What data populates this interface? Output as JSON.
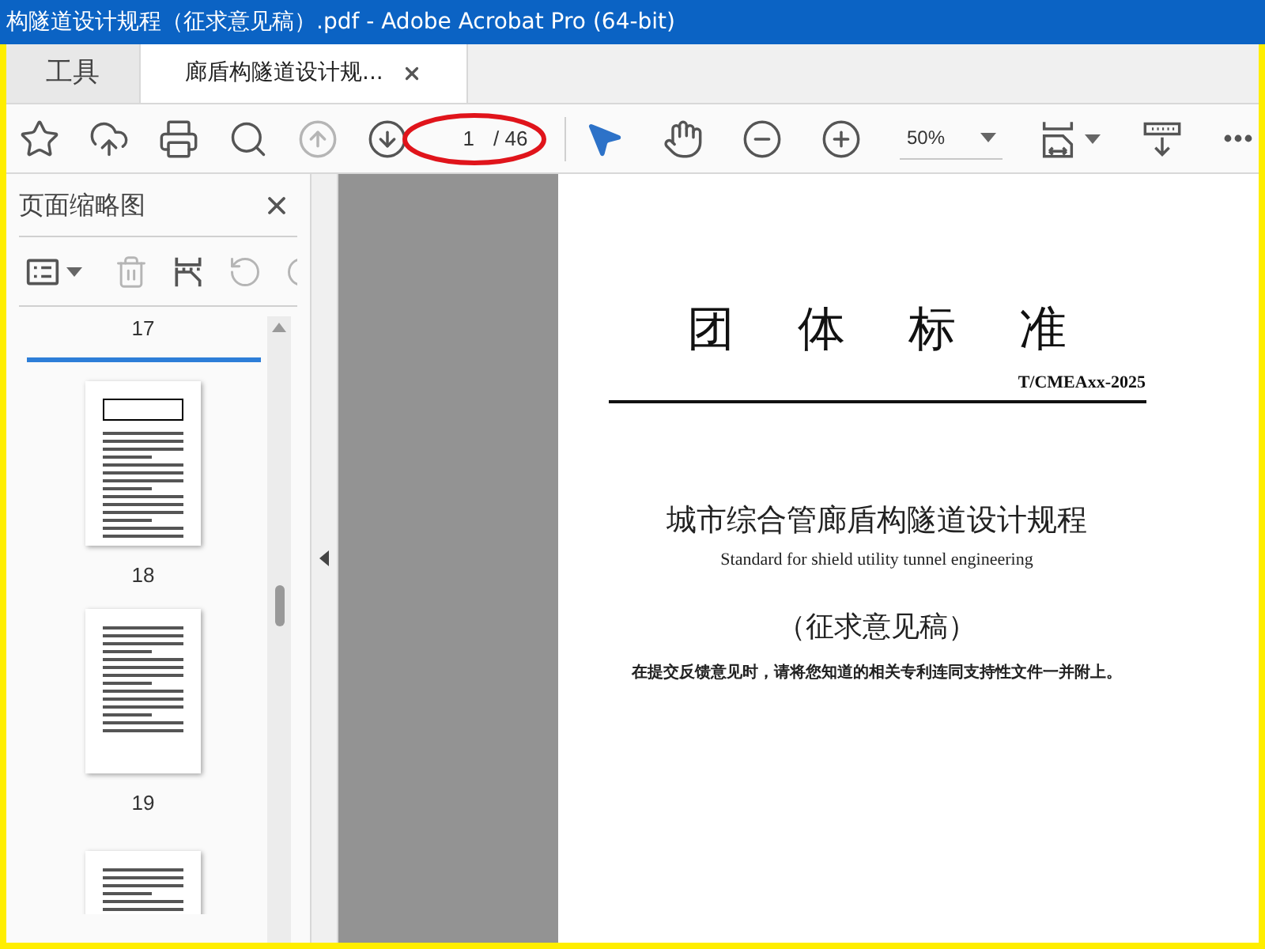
{
  "window": {
    "title": "构隧道设计规程（征求意见稿）.pdf - Adobe Acrobat Pro (64-bit)"
  },
  "tabs": [
    {
      "label": "工具",
      "selected": false,
      "closable": false
    },
    {
      "label": "廊盾构隧道设计规...",
      "selected": true,
      "closable": true
    }
  ],
  "toolbar": {
    "left": [
      {
        "kind": "star",
        "disabled": false
      },
      {
        "kind": "upload",
        "disabled": false
      },
      {
        "kind": "print",
        "disabled": false
      },
      {
        "kind": "search",
        "disabled": false
      },
      {
        "kind": "prev-page",
        "disabled": true
      },
      {
        "kind": "next-page",
        "disabled": false
      }
    ],
    "page": {
      "current": "1",
      "total": "/ 46"
    },
    "tools": [
      {
        "kind": "select",
        "selected": true
      },
      {
        "kind": "hand",
        "selected": false
      }
    ],
    "zoom": [
      {
        "kind": "zoom-out",
        "disabled": false
      },
      {
        "kind": "zoom-in",
        "disabled": false
      }
    ],
    "zoom_value": "50%",
    "right": [
      {
        "kind": "fit",
        "disabled": false
      },
      {
        "kind": "scroll",
        "disabled": false
      },
      {
        "kind": "more",
        "disabled": false
      }
    ]
  },
  "sidebar": {
    "title": "页面缩略图",
    "tools": [
      {
        "kind": "options",
        "disabled": false
      },
      {
        "kind": "delete",
        "disabled": true
      },
      {
        "kind": "extract",
        "disabled": false
      },
      {
        "kind": "rotate-ccw",
        "disabled": true
      },
      {
        "kind": "rotate-cw",
        "disabled": true
      }
    ],
    "thumbnails": [
      {
        "kind": "cut-top",
        "label": "17",
        "selected": true
      },
      {
        "kind": "full",
        "label": "18",
        "selected": false
      },
      {
        "kind": "full",
        "label": "19",
        "selected": false
      },
      {
        "kind": "cut-bottom",
        "selected": false
      }
    ]
  },
  "document": {
    "heading": "团体标准",
    "code": "T/CMEAxx-2025",
    "title": "城市综合管廊盾构隧道设计规程",
    "subtitle": "Standard for shield utility tunnel engineering",
    "draft": "（征求意见稿）",
    "note": "在提交反馈意见时，请将您知道的相关专利连同支持性文件一并附上。"
  }
}
